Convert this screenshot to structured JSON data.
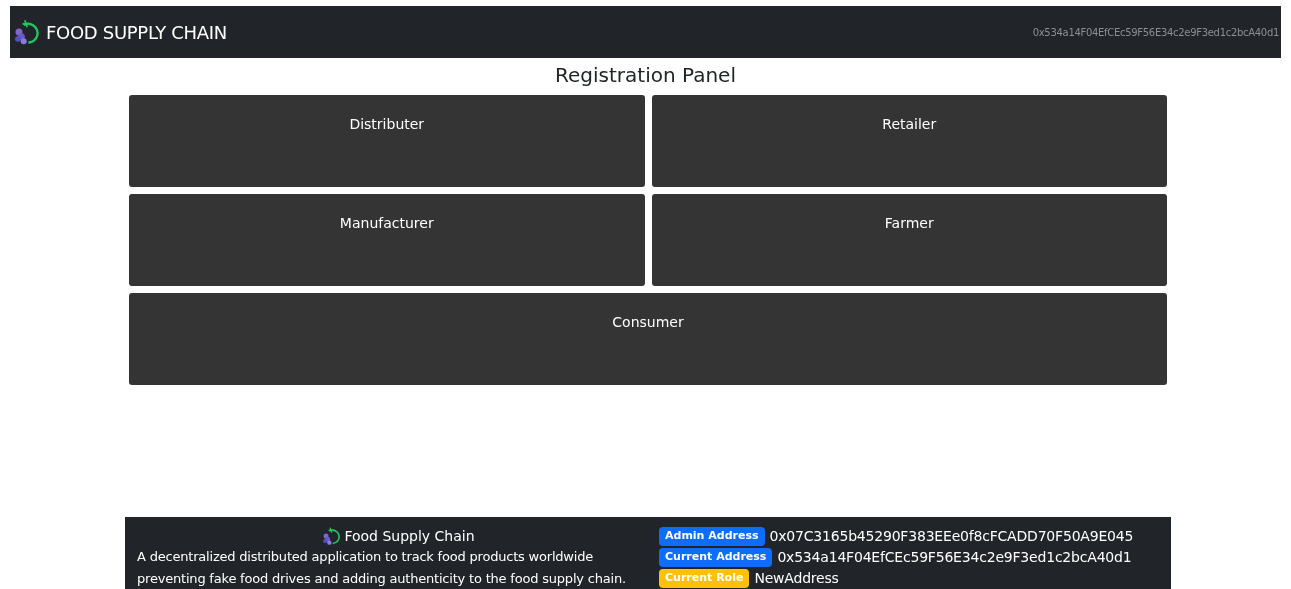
{
  "navbar": {
    "brand": "FOOD SUPPLY CHAIN",
    "account": "0x534a14F04EfCEc59F56E34c2e9F3ed1c2bcA40d1"
  },
  "panel": {
    "title": "Registration Panel",
    "roles": [
      {
        "label": "Distributer"
      },
      {
        "label": "Retailer"
      },
      {
        "label": "Manufacturer"
      },
      {
        "label": "Farmer"
      },
      {
        "label": "Consumer"
      }
    ]
  },
  "footer": {
    "title": "Food Supply Chain",
    "description": "A decentralized distributed application to track food products worldwide preventing fake food drives and adding authenticity to the food supply chain.",
    "details": [
      {
        "badge": "Admin Address",
        "kind": "primary",
        "value": "0x07C3165b45290F383EEe0f8cFCADD70F50A9E045"
      },
      {
        "badge": "Current Address",
        "kind": "primary",
        "value": "0x534a14F04EfCEc59F56E34c2e9F3ed1c2bcA40d1"
      },
      {
        "badge": "Current Role",
        "kind": "warning",
        "value": "NewAddress"
      }
    ]
  }
}
